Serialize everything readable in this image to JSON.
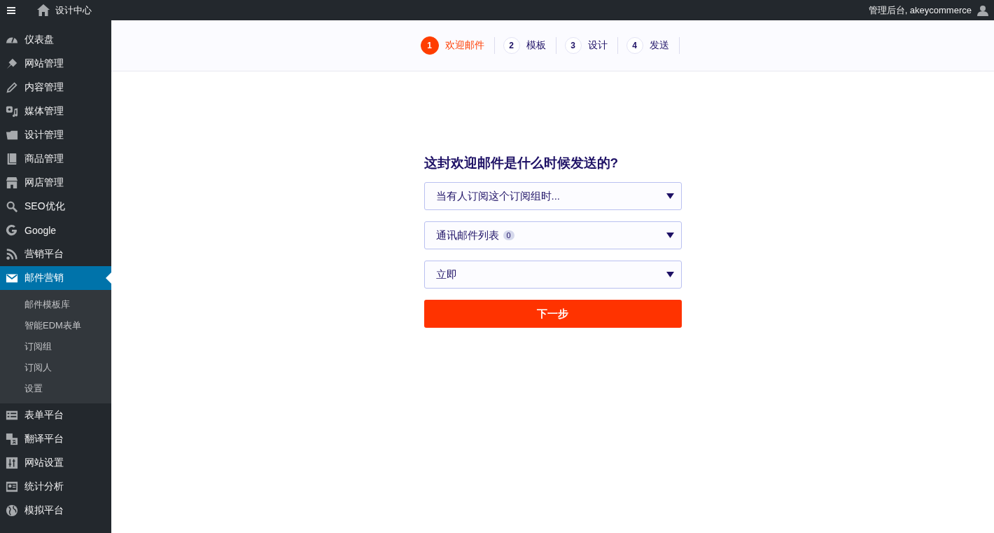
{
  "topbar": {
    "site_title": "设计中心",
    "account": "管理后台, akeycommerce"
  },
  "sidebar": {
    "items": [
      {
        "label": "仪表盘",
        "selected": false
      },
      {
        "label": "网站管理",
        "selected": false
      },
      {
        "label": "内容管理",
        "selected": false
      },
      {
        "label": "媒体管理",
        "selected": false
      },
      {
        "label": "设计管理",
        "selected": false
      },
      {
        "label": "商品管理",
        "selected": false
      },
      {
        "label": "网店管理",
        "selected": false
      },
      {
        "label": "SEO优化",
        "selected": false
      },
      {
        "label": "Google",
        "selected": false
      },
      {
        "label": "营销平台",
        "selected": false
      },
      {
        "label": "邮件营销",
        "selected": true,
        "children": [
          {
            "label": "邮件模板库"
          },
          {
            "label": "智能EDM表单"
          },
          {
            "label": "订阅组"
          },
          {
            "label": "订阅人"
          },
          {
            "label": "设置"
          }
        ]
      },
      {
        "label": "表单平台",
        "selected": false
      },
      {
        "label": "翻译平台",
        "selected": false
      },
      {
        "label": "网站设置",
        "selected": false
      },
      {
        "label": "统计分析",
        "selected": false
      },
      {
        "label": "模拟平台",
        "selected": false
      }
    ]
  },
  "steps": [
    {
      "number": "1",
      "label": "欢迎邮件",
      "selected": true
    },
    {
      "number": "2",
      "label": "模板",
      "selected": false
    },
    {
      "number": "3",
      "label": "设计",
      "selected": false
    },
    {
      "number": "4",
      "label": "发送",
      "selected": false
    }
  ],
  "form": {
    "question": "这封欢迎邮件是什么时候发送的?",
    "selects": [
      {
        "value": "当有人订阅这个订阅组时..."
      },
      {
        "value": "通讯邮件列表",
        "badge": "0"
      },
      {
        "value": "立即"
      }
    ],
    "next_button": "下一步"
  }
}
